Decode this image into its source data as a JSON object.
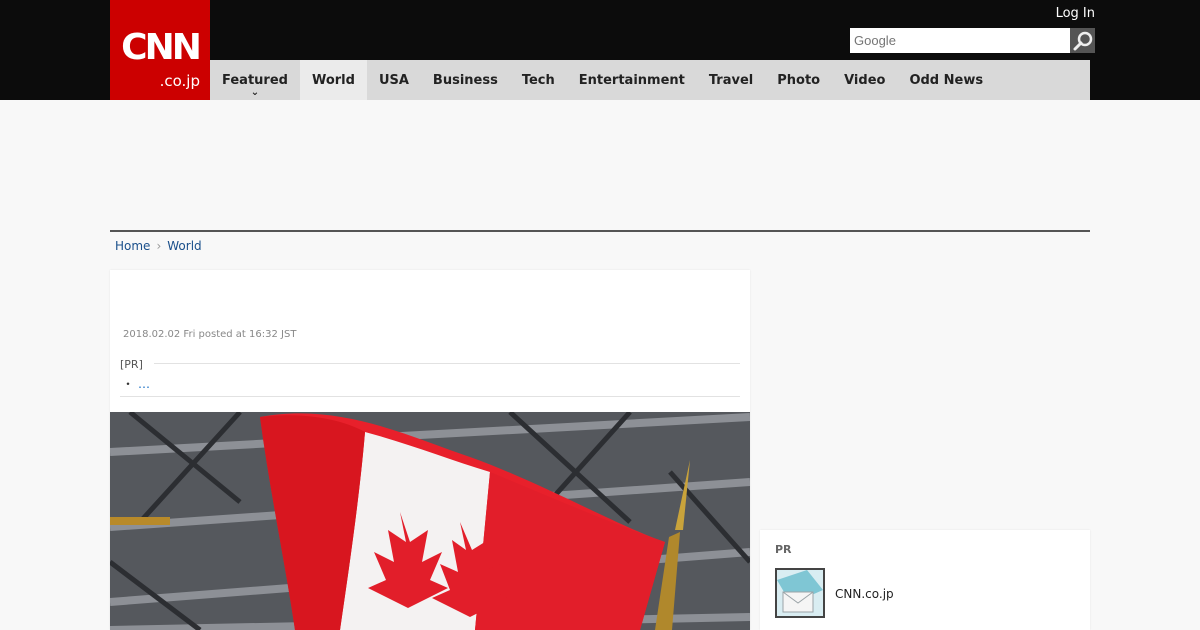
{
  "header": {
    "logo": {
      "text": "CNN",
      "subtext": ".co.jp"
    },
    "login_label": "Log In",
    "search": {
      "placeholder": "Google",
      "icon": "search-icon"
    }
  },
  "nav": {
    "active": "World",
    "items": [
      {
        "label": "Featured",
        "has_dropdown": true
      },
      {
        "label": "World"
      },
      {
        "label": "USA"
      },
      {
        "label": "Business"
      },
      {
        "label": "Tech"
      },
      {
        "label": "Entertainment"
      },
      {
        "label": "Travel"
      },
      {
        "label": "Photo"
      },
      {
        "label": "Video"
      },
      {
        "label": "Odd News"
      }
    ]
  },
  "breadcrumb": {
    "home": "Home",
    "section": "World"
  },
  "article": {
    "date": "2018.02.02 Fri posted at 16:32 JST",
    "pr_tag": "[PR]",
    "pr_bullet": "・",
    "pr_link": "…",
    "photo": "canadian-flag-photo"
  },
  "sidebar": {
    "pr_label": "PR",
    "item_label": "CNN.co.jp",
    "item_icon": "mail-thumbnail"
  },
  "colors": {
    "topbar": "#0c0c0c",
    "logo_red": "#cc0000",
    "nav_bg": "#d9d9d9",
    "nav_active": "#ebebeb",
    "link": "#1a4f8b",
    "page_bg": "#f8f8f8"
  }
}
